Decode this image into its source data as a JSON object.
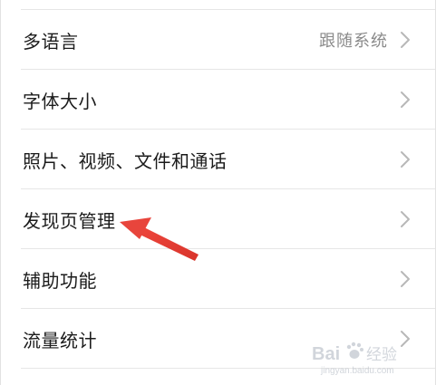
{
  "settings": {
    "items": [
      {
        "label": "多语言",
        "value": "跟随系统"
      },
      {
        "label": "字体大小"
      },
      {
        "label": "照片、视频、文件和通话"
      },
      {
        "label": "发现页管理"
      },
      {
        "label": "辅助功能"
      },
      {
        "label": "流量统计"
      }
    ]
  },
  "colors": {
    "annotation_arrow": "#e8453c"
  },
  "icons": {
    "row_chevron": "chevron-right-icon"
  },
  "watermark": {
    "brand": "Bai",
    "brand_suffix": "经验",
    "url": "jingyan.baidu.com"
  }
}
